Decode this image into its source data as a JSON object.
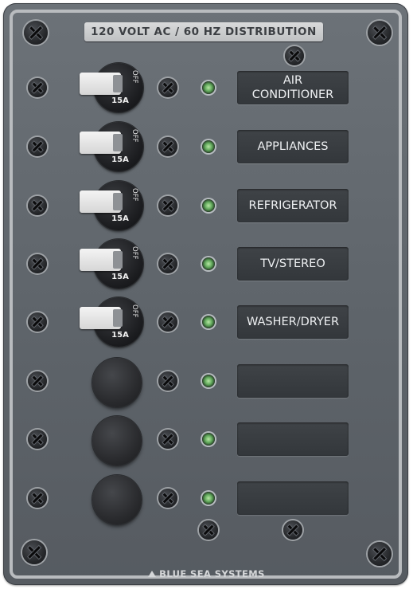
{
  "panel": {
    "title": "120 VOLT AC / 60 HZ DISTRIBUTION",
    "brand": "BLUE SEA SYSTEMS"
  },
  "breakers": [
    {
      "label": "AIR\nCONDITIONER",
      "amps": "15A",
      "state": "OFF",
      "installed": true
    },
    {
      "label": "APPLIANCES",
      "amps": "15A",
      "state": "OFF",
      "installed": true
    },
    {
      "label": "REFRIGERATOR",
      "amps": "15A",
      "state": "OFF",
      "installed": true
    },
    {
      "label": "TV/STEREO",
      "amps": "15A",
      "state": "OFF",
      "installed": true
    },
    {
      "label": "WASHER/DRYER",
      "amps": "15A",
      "state": "OFF",
      "installed": true
    },
    {
      "label": "",
      "amps": "",
      "state": "",
      "installed": false
    },
    {
      "label": "",
      "amps": "",
      "state": "",
      "installed": false
    },
    {
      "label": "",
      "amps": "",
      "state": "",
      "installed": false
    }
  ],
  "colors": {
    "panel": "#5e646a",
    "label_plate": "#3a3e42",
    "led_green": "#6fbf5e",
    "title_plate": "#cfd1d3"
  }
}
